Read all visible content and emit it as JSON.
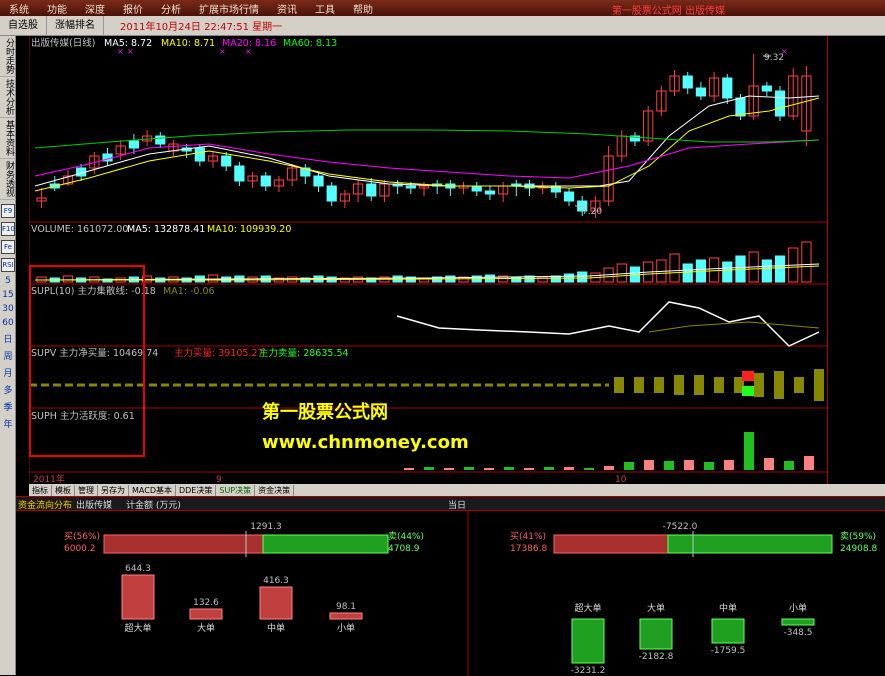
{
  "menu": {
    "items": [
      "系统",
      "功能",
      "深度",
      "报价",
      "分析",
      "扩展市场行情",
      "资讯",
      "工具",
      "帮助"
    ],
    "title_right": "第一股票公式网 出版传媒"
  },
  "toolbar": {
    "tabs": [
      "自选股",
      "涨幅排名"
    ],
    "datetime": "2011年10月24日  22:47:51 星期一"
  },
  "sidebar": {
    "tabs": [
      "分时走势",
      "技术分析",
      "基本资料",
      "财务透视"
    ],
    "icons": [
      "F9",
      "F10",
      "Fe",
      "Fd",
      "F1",
      "F2",
      "RSI"
    ],
    "periods": [
      "5",
      "15",
      "30",
      "60",
      "日",
      "周",
      "月",
      "多",
      "季",
      "年"
    ]
  },
  "main_chart": {
    "title": "出版传媒(日线)",
    "ma5": "MA5: 8.72",
    "ma10": "MA10: 8.71",
    "ma20": "MA20: 8.16",
    "ma60": "MA60: 8.13",
    "high_label": "9.32",
    "low_label": "7.20"
  },
  "volume": {
    "label": "VOLUME: 161072.00",
    "ma5": "MA5: 132878.41",
    "ma10": "MA10: 109939.20"
  },
  "supl": {
    "label": "SUPL(10) 主力集散线: -0.18",
    "ma": "MA1: -0.06"
  },
  "supv": {
    "label": "SUPV 主力净买量: 10469.74",
    "buy": "主力买量: 39105.27",
    "sell": "主力卖量: 28635.54"
  },
  "suph": {
    "label": "SUPH 主力活跃度: 0.61"
  },
  "xaxis": {
    "labels": [
      "2011年",
      "9",
      "10"
    ]
  },
  "bottom_tabs": [
    "指标",
    "模板",
    "管理",
    "另存为",
    "MACD基本",
    "DDE决策",
    "SUP决策",
    "资金决策"
  ],
  "flow": {
    "head_title": "资金流向分布",
    "stock": "出版传媒",
    "unit": "计金额 (万元)",
    "period": "当日",
    "left": {
      "total": "1291.3",
      "buy_label": "买(56%)",
      "buy_value": "6000.2",
      "sell_label": "卖(44%)",
      "sell_value": "4708.9",
      "bars": [
        {
          "name": "超大单",
          "value": "644.3"
        },
        {
          "name": "大单",
          "value": "132.6"
        },
        {
          "name": "中单",
          "value": "416.3"
        },
        {
          "name": "小单",
          "value": "98.1"
        }
      ]
    },
    "right": {
      "total": "-7522.0",
      "buy_label": "买(41%)",
      "buy_value": "17386.8",
      "sell_label": "卖(59%)",
      "sell_value": "24908.8",
      "bars": [
        {
          "name": "超大单",
          "value": "-3231.2"
        },
        {
          "name": "大单",
          "value": "-2182.8"
        },
        {
          "name": "中单",
          "value": "-1759.5"
        },
        {
          "name": "小单",
          "value": "-348.5"
        }
      ]
    }
  },
  "watermark": {
    "line1": "第一股票公式网",
    "line2": "www.chnmoney.com"
  },
  "colors": {
    "up": "#ff4040",
    "down": "#54ffff",
    "ma5": "#ffffff",
    "ma10": "#ffff00",
    "ma20": "#ff00ff",
    "ma60": "#00ff00"
  }
}
